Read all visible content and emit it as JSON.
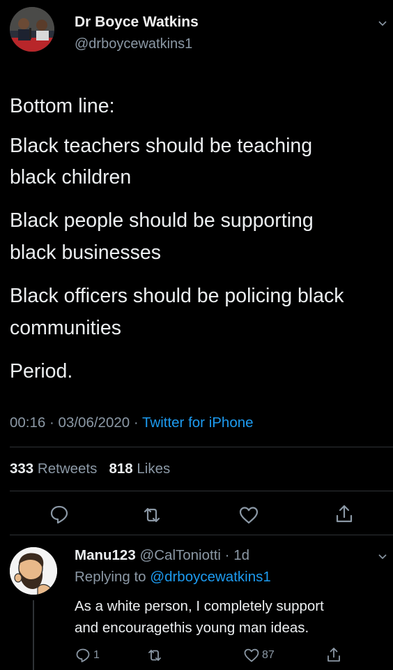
{
  "tweet": {
    "display_name": "Dr Boyce Watkins",
    "handle": "@drboycewatkins1",
    "lines": [
      "Bottom line:",
      "Black teachers should be teaching",
      "black children",
      "Black people should be supporting",
      "black businesses",
      "Black officers should be policing black",
      "communities",
      "Period."
    ],
    "time": "00:16",
    "date": "03/06/2020",
    "source": "Twitter for iPhone",
    "retweets_count": "333",
    "retweets_label": "Retweets",
    "likes_count": "818",
    "likes_label": "Likes"
  },
  "actions": {
    "reply_icon": "reply-icon",
    "retweet_icon": "retweet-icon",
    "like_icon": "heart-icon",
    "share_icon": "share-icon"
  },
  "reply": {
    "display_name": "Manu123",
    "handle": "@CalToniotti",
    "age": "1d",
    "replying_prefix": "Replying to",
    "replying_to": "@drboycewatkins1",
    "lines": [
      "As a white person, I completely support",
      "and encouragethis young man ideas."
    ],
    "reply_count": "1",
    "retweet_count": "",
    "like_count": "87"
  },
  "colors": {
    "background": "#000000",
    "text": "#e7e9ea",
    "muted": "#8b98a5",
    "link": "#1d9bf0",
    "divider": "#2f3336"
  }
}
